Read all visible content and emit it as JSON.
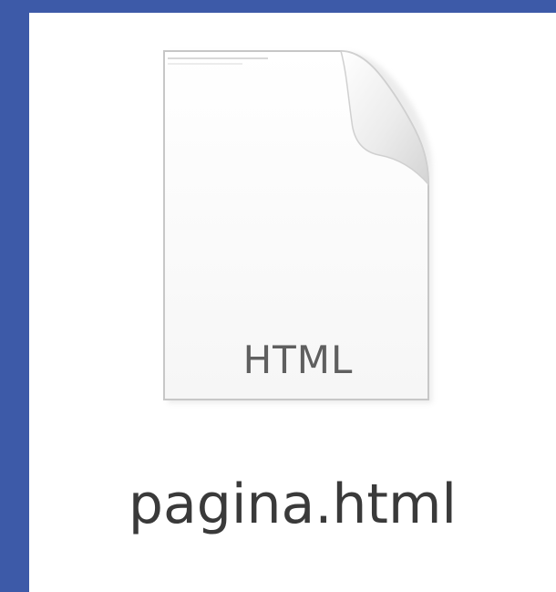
{
  "file": {
    "icon": "html-document-icon",
    "type_label": "HTML",
    "name": "pagina.html"
  },
  "colors": {
    "desktop_background": "#3d5aa8",
    "window_background": "#ffffff",
    "label_text": "#3a3a3a",
    "icon_text": "#5f5f5f"
  }
}
